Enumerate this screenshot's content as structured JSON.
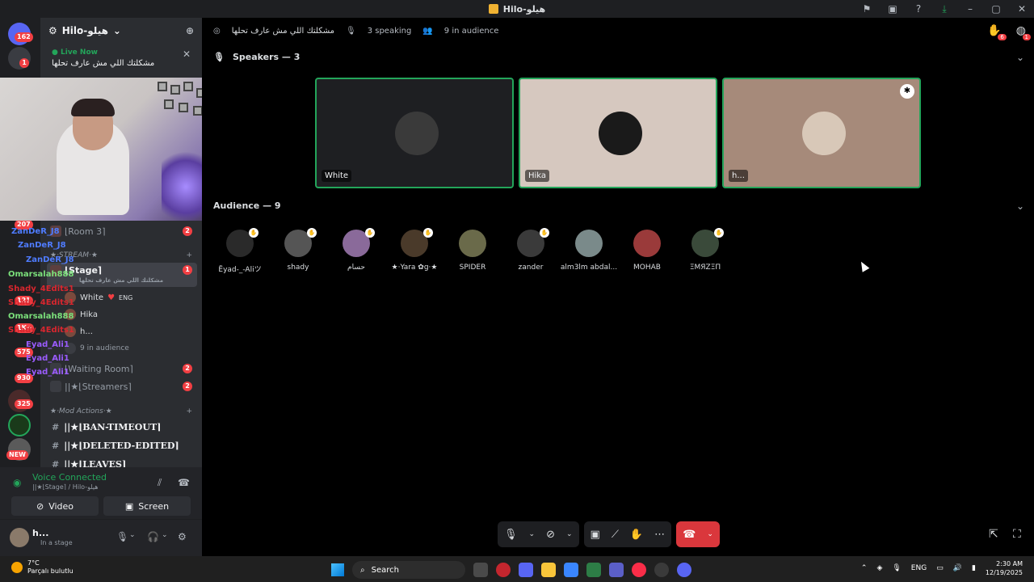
{
  "window": {
    "title": "Hilo-هيلو"
  },
  "server": {
    "name": "Hilo-هيلو",
    "live_label": "Live Now",
    "live_title": "مشكلتك اللي مش عارف تحلها"
  },
  "rail": {
    "badges": [
      "162",
      "1",
      "207",
      "121",
      "1K+",
      "575",
      "930",
      "325",
      "NEW"
    ]
  },
  "overlay_names": [
    {
      "text": "ZanDeR_J8",
      "color": "#4f7cff"
    },
    {
      "text": "ZanDeR_J8",
      "color": "#4f7cff"
    },
    {
      "text": "ZanDeR_J8",
      "color": "#4f7cff"
    },
    {
      "text": "Omarsalah888",
      "color": "#7be07b"
    },
    {
      "text": "Shady_4Edits1",
      "color": "#d9262e"
    },
    {
      "text": "Shady_4Edits1",
      "color": "#d9262e"
    },
    {
      "text": "Omarsalah888",
      "color": "#7be07b"
    },
    {
      "text": "Shady_4Edits1",
      "color": "#d9262e"
    },
    {
      "text": "Eyad_Ali1",
      "color": "#9b5cff"
    },
    {
      "text": "Eyad_Ali1",
      "color": "#9b5cff"
    },
    {
      "text": "Eyad_Ali1",
      "color": "#9b5cff"
    }
  ],
  "channels": {
    "room3": {
      "label": "⌊Room 3⌉",
      "badge": "2"
    },
    "category_stream": "★·STREAM·★",
    "stage": {
      "label": "⌊Stage⌉",
      "sub": "مشكلتك اللي مش عارف تحلها",
      "badge": "1"
    },
    "stage_members": [
      {
        "name": "White",
        "tag": "ENG"
      },
      {
        "name": "Hika",
        "tag": ""
      },
      {
        "name": "h...",
        "tag": ""
      }
    ],
    "stage_audience": "9 in audience",
    "waiting_room": {
      "label": "⌊Waiting Room⌉",
      "badge": "2"
    },
    "streamers": {
      "label": "||★⌊Streamers⌉",
      "badge": "2"
    },
    "category_mod": "★·Mod Actions·★",
    "text_channels": [
      "||★⌊BAN-TIMEOUT⌉",
      "||★⌊DELETED-EDITED⌉",
      "||★⌊LEAVES⌉"
    ]
  },
  "voice": {
    "status": "Voice Connected",
    "location": "||★⌊Stage⌉ / Hilo-هيلو",
    "video_label": "Video",
    "screen_label": "Screen"
  },
  "user": {
    "name": "h...",
    "status": "In a stage"
  },
  "stage": {
    "title": "مشكلتك اللي مش عارف تحلها",
    "speaking": "3 speaking",
    "audience_count": "9 in audience",
    "speakers_header": "Speakers — 3",
    "audience_header": "Audience — 9",
    "notif_badge_1": "6",
    "notif_badge_2": "1",
    "speakers": [
      {
        "name": "White",
        "bg": "#1e1f22",
        "avatar": "#3a3a3a",
        "mod": false
      },
      {
        "name": "Hika",
        "bg": "#d6c8bf",
        "avatar": "#1a1a1a",
        "mod": false
      },
      {
        "name": "h...",
        "bg": "#a68a7a",
        "avatar": "#d8c8b8",
        "mod": true
      }
    ],
    "audience": [
      {
        "name": "Ëyad-_-Aliツ",
        "color": "#2a2a2a"
      },
      {
        "name": "shady",
        "color": "#555"
      },
      {
        "name": "حسام",
        "color": "#8a6a9a"
      },
      {
        "name": "★·Yara ✿g·★",
        "color": "#4a3a2a"
      },
      {
        "name": "SPIDER",
        "color": "#6a6a4a"
      },
      {
        "name": "zander",
        "color": "#3a3a3a"
      },
      {
        "name": "alm3lm abdal...",
        "color": "#7a8a8a"
      },
      {
        "name": "MOHAB",
        "color": "#9a3a3a"
      },
      {
        "name": "ΞΜЯŽΞΠ",
        "color": "#3a4a3a"
      }
    ]
  },
  "taskbar": {
    "temp": "7°C",
    "weather": "Parçalı bulutlu",
    "search": "Search",
    "lang": "ENG",
    "time": "2:30 AM",
    "date": "12/19/2025"
  }
}
